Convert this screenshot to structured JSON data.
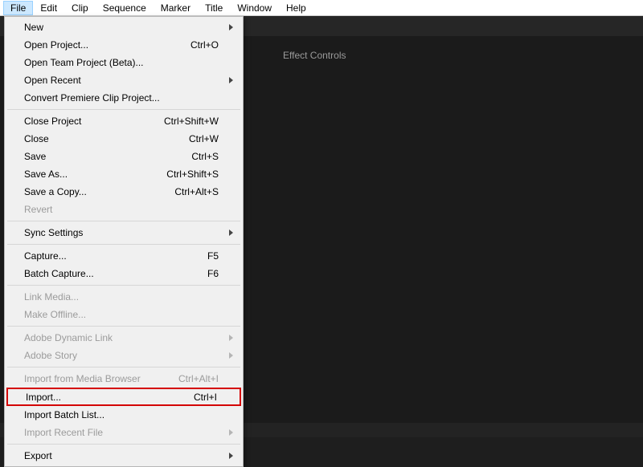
{
  "menubar": {
    "items": [
      {
        "label": "File"
      },
      {
        "label": "Edit"
      },
      {
        "label": "Clip"
      },
      {
        "label": "Sequence"
      },
      {
        "label": "Marker"
      },
      {
        "label": "Title"
      },
      {
        "label": "Window"
      },
      {
        "label": "Help"
      }
    ]
  },
  "panel": {
    "effect_controls": "Effect Controls"
  },
  "file_menu": {
    "new": "New",
    "open_project": "Open Project...",
    "open_project_sc": "Ctrl+O",
    "open_team": "Open Team Project (Beta)...",
    "open_recent": "Open Recent",
    "convert_clip": "Convert Premiere Clip Project...",
    "close_project": "Close Project",
    "close_project_sc": "Ctrl+Shift+W",
    "close": "Close",
    "close_sc": "Ctrl+W",
    "save": "Save",
    "save_sc": "Ctrl+S",
    "save_as": "Save As...",
    "save_as_sc": "Ctrl+Shift+S",
    "save_copy": "Save a Copy...",
    "save_copy_sc": "Ctrl+Alt+S",
    "revert": "Revert",
    "sync_settings": "Sync Settings",
    "capture": "Capture...",
    "capture_sc": "F5",
    "batch_capture": "Batch Capture...",
    "batch_capture_sc": "F6",
    "link_media": "Link Media...",
    "make_offline": "Make Offline...",
    "adobe_dynamic": "Adobe Dynamic Link",
    "adobe_story": "Adobe Story",
    "import_media_browser": "Import from Media Browser",
    "import_media_browser_sc": "Ctrl+Alt+I",
    "import": "Import...",
    "import_sc": "Ctrl+I",
    "import_batch": "Import Batch List...",
    "import_recent": "Import Recent File",
    "export": "Export"
  }
}
